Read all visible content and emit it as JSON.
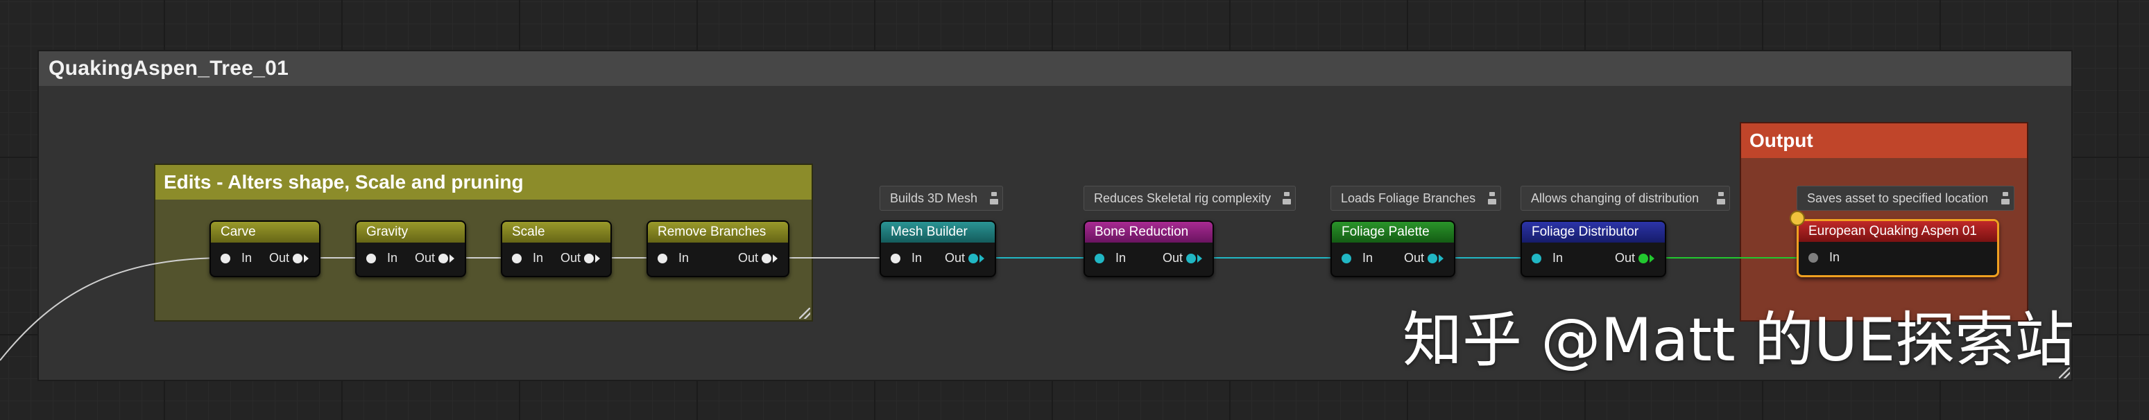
{
  "graph": {
    "title": "QuakingAspen_Tree_01",
    "comments": {
      "edits_title": "Edits - Alters shape, Scale and pruning",
      "output_title": "Output"
    },
    "pin_labels": {
      "in": "In",
      "out": "Out"
    },
    "nodes": [
      {
        "name": "Carve",
        "header_color": "#7d7d1f"
      },
      {
        "name": "Gravity",
        "header_color": "#7d7d1f"
      },
      {
        "name": "Scale",
        "header_color": "#7d7d1f"
      },
      {
        "name": "Remove Branches",
        "header_color": "#7d7d1f"
      },
      {
        "name": "Mesh Builder",
        "header_color": "#1c7a7a",
        "description": "Builds 3D Mesh"
      },
      {
        "name": "Bone Reduction",
        "header_color": "#8a1f78",
        "description": "Reduces Skeletal rig complexity"
      },
      {
        "name": "Foliage Palette",
        "header_color": "#1e7a1e",
        "description": "Loads Foliage Branches"
      },
      {
        "name": "Foliage Distributor",
        "header_color": "#22288c",
        "description": "Allows changing of distribution"
      },
      {
        "name": "European Quaking Aspen 01",
        "header_color": "#a51d1d",
        "description": "Saves asset to specified location"
      }
    ]
  },
  "colors": {
    "exec_wire": "#cfcfcf",
    "mesh_wire": "#21b7c4",
    "foliage_wire": "#22c82f",
    "selection_outline": "#f0a020",
    "reroute_dot": "#f0c23c"
  },
  "watermark": "知乎 @Matt 的UE探索站"
}
